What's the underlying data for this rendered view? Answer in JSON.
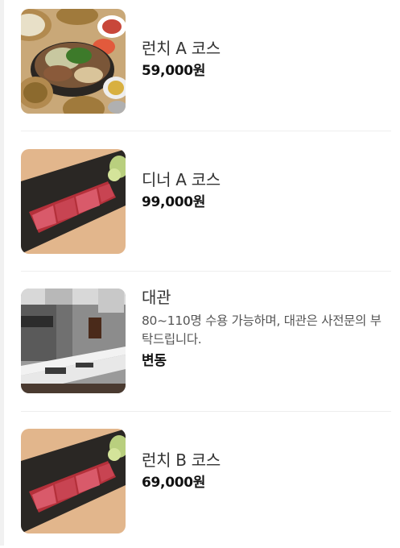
{
  "menu": {
    "items": [
      {
        "name": "런치 A 코스",
        "description": "",
        "price": "59,000원",
        "image": "korean-bbq-spread-photo"
      },
      {
        "name": "디너 A 코스",
        "description": "",
        "price": "99,000원",
        "image": "sliced-steak-photo"
      },
      {
        "name": "대관",
        "description": "80~110명 수용 가능하며, 대관은 사전문의 부탁드립니다.",
        "price": "변동",
        "image": "restaurant-interior-photo"
      },
      {
        "name": "런치 B 코스",
        "description": "",
        "price": "69,000원",
        "image": "sliced-steak-photo"
      }
    ]
  }
}
